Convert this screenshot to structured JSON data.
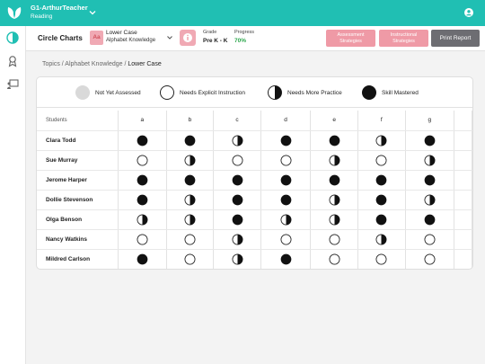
{
  "app": {
    "class_name": "G1-ArthurTeacher",
    "subject": "Reading"
  },
  "header": {
    "title": "Circle Charts",
    "topic_badge": "Aa",
    "topic_title": "Lower Case",
    "topic_sub": "Alphabet Knowledge",
    "grade_label": "Grade",
    "grade_value": "Pre K - K",
    "progress_label": "Progress",
    "progress_value": "70%",
    "assessment_btn": "Assessment Strategies",
    "instructional_btn": "Instructional Strategies",
    "print_btn": "Print Report"
  },
  "breadcrumb": {
    "topics": "Topics",
    "sep1": " / ",
    "section": "Alphabet Knowledge",
    "sep2": " / ",
    "current": "Lower Case"
  },
  "legend": [
    {
      "status": "not_assessed",
      "label": "Not Yet Assessed"
    },
    {
      "status": "explicit",
      "label": "Needs Explicit Instruction"
    },
    {
      "status": "practice",
      "label": "Needs More Practice"
    },
    {
      "status": "mastered",
      "label": "Skill Mastered"
    }
  ],
  "table": {
    "students_header": "Students",
    "columns": [
      "a",
      "b",
      "c",
      "d",
      "e",
      "f",
      "g"
    ],
    "rows": [
      {
        "name": "Clara Todd",
        "cells": [
          "mastered",
          "mastered",
          "practice",
          "mastered",
          "mastered",
          "practice",
          "mastered"
        ]
      },
      {
        "name": "Sue Murray",
        "cells": [
          "explicit",
          "practice",
          "explicit",
          "explicit",
          "practice",
          "explicit",
          "practice"
        ]
      },
      {
        "name": "Jerome Harper",
        "cells": [
          "mastered",
          "mastered",
          "mastered",
          "mastered",
          "mastered",
          "mastered",
          "mastered"
        ]
      },
      {
        "name": "Dollie Stevenson",
        "cells": [
          "mastered",
          "practice",
          "mastered",
          "mastered",
          "practice",
          "mastered",
          "practice"
        ]
      },
      {
        "name": "Olga Benson",
        "cells": [
          "practice",
          "practice",
          "mastered",
          "practice",
          "practice",
          "mastered",
          "mastered"
        ]
      },
      {
        "name": "Nancy Watkins",
        "cells": [
          "explicit",
          "explicit",
          "practice",
          "explicit",
          "explicit",
          "practice",
          "explicit"
        ]
      },
      {
        "name": "Mildred Carlson",
        "cells": [
          "mastered",
          "explicit",
          "practice",
          "mastered",
          "explicit",
          "explicit",
          "explicit"
        ]
      }
    ]
  },
  "colors": {
    "topbar": "#20bfb3",
    "accent_pink": "#ef9aa6",
    "print_btn": "#6d6d72",
    "progress_green": "#2fa84f",
    "not_assessed_fill": "#d9d9d9"
  },
  "icons": [
    "leaf-logo-icon",
    "chevron-down-icon",
    "user-account-icon",
    "circle-chart-icon",
    "award-icon",
    "teacher-board-icon",
    "info-icon"
  ]
}
